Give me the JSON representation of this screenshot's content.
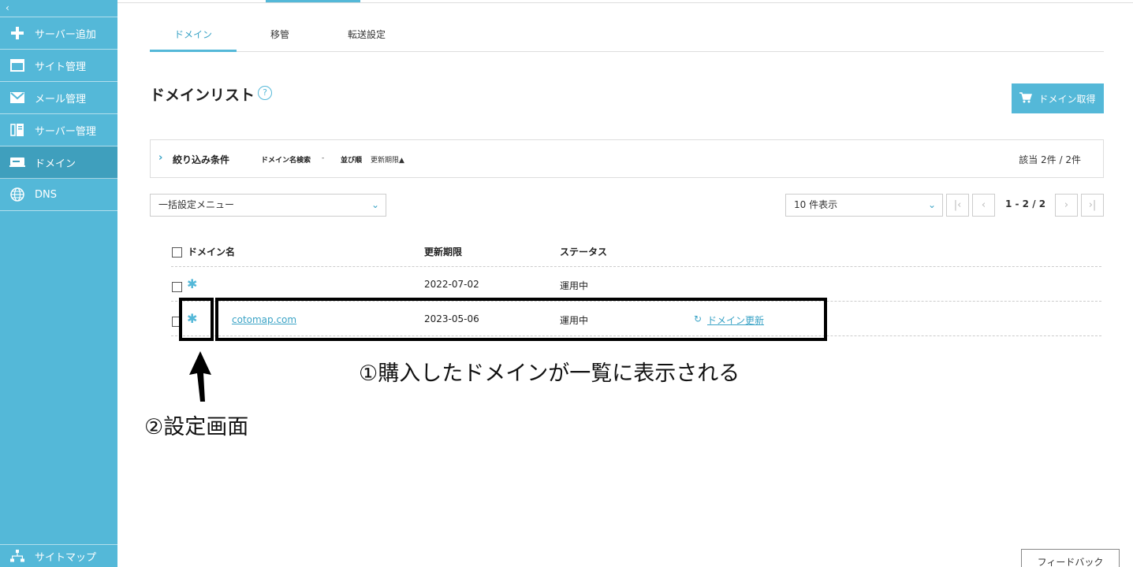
{
  "sidebar": {
    "collapse_glyph": "‹",
    "items": [
      {
        "label": "サーバー追加",
        "icon": "plus-icon"
      },
      {
        "label": "サイト管理",
        "icon": "window-icon"
      },
      {
        "label": "メール管理",
        "icon": "mail-icon"
      },
      {
        "label": "サーバー管理",
        "icon": "server-icon"
      },
      {
        "label": "ドメイン",
        "icon": "dotcom-icon",
        "active": true
      },
      {
        "label": "DNS",
        "icon": "globe-icon"
      }
    ],
    "sitemap_label": "サイトマップ"
  },
  "tabs": [
    {
      "label": "ドメイン",
      "active": true
    },
    {
      "label": "移管"
    },
    {
      "label": "転送設定"
    }
  ],
  "page_title": "ドメインリスト",
  "help_glyph": "?",
  "get_domain_button": "ドメイン取得",
  "filter": {
    "chevron": "›",
    "title": "絞り込み条件",
    "search_key": "ドメイン名検索",
    "search_value": "-",
    "sort_key": "並び順",
    "sort_value": "更新期限▲",
    "count": "該当 2件 / 2件"
  },
  "bulk_menu": {
    "value": "一括設定メニュー",
    "caret": "⌄"
  },
  "per_page": {
    "value": "10 件表示",
    "caret": "⌄"
  },
  "pagination": {
    "first": "|‹",
    "prev": "‹",
    "range": "1 - 2 / 2",
    "next": "›",
    "last": "›|"
  },
  "table": {
    "headers": [
      "ドメイン名",
      "更新期限",
      "ステータス"
    ],
    "rows": [
      {
        "domain": "",
        "expiry": "2022-07-02",
        "status": "運用中",
        "action": ""
      },
      {
        "domain": "cotomap.com",
        "expiry": "2023-05-06",
        "status": "運用中",
        "action": "ドメイン更新"
      }
    ]
  },
  "annotations": {
    "note1": "①購入したドメインが一覧に表示される",
    "note2": "②設定画面"
  },
  "feedback_button": "フィードバック",
  "colors": {
    "accent": "#54b8d8",
    "sidebar_active": "#3f9fbd",
    "link": "#3aa3c6"
  }
}
